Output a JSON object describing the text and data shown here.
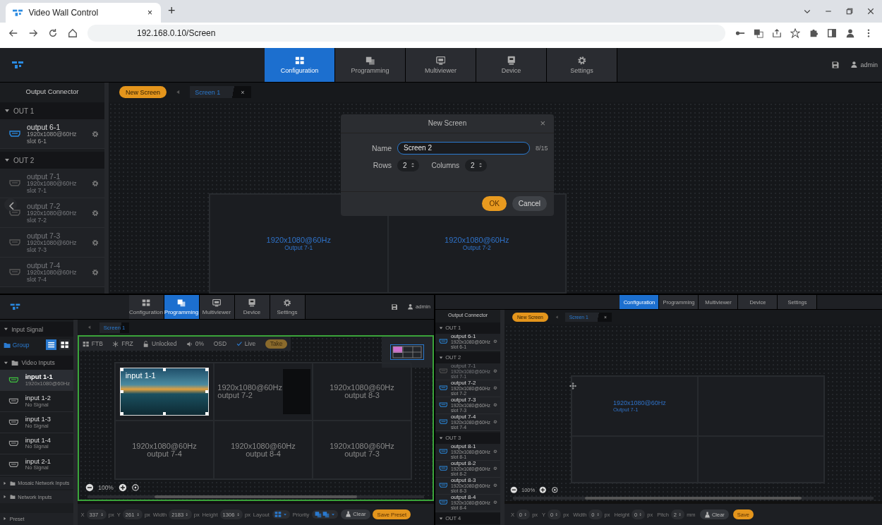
{
  "browser": {
    "tab_title": "Video Wall Control",
    "tab_close": "×",
    "new_tab": "+",
    "address": "192.168.0.10/Screen"
  },
  "top_app": {
    "nav": [
      {
        "label": "Configuration",
        "selected": true
      },
      {
        "label": "Programming",
        "selected": false
      },
      {
        "label": "Multiviewer",
        "selected": false
      },
      {
        "label": "Device",
        "selected": false
      },
      {
        "label": "Settings",
        "selected": false
      }
    ],
    "user": "admin",
    "sidebar_title": "Output Connector",
    "groups": [
      {
        "label": "OUT 1",
        "expanded": true,
        "outputs": [
          {
            "name": "output 6-1",
            "resolution": "1920x1080@60Hz",
            "slot": "slot 6-1",
            "active": true
          }
        ]
      },
      {
        "label": "OUT 2",
        "expanded": true,
        "outputs": [
          {
            "name": "output 7-1",
            "resolution": "1920x1080@60Hz",
            "slot": "slot 7-1",
            "active": false
          },
          {
            "name": "output 7-2",
            "resolution": "1920x1080@60Hz",
            "slot": "slot 7-2",
            "active": false
          },
          {
            "name": "output 7-3",
            "resolution": "1920x1080@60Hz",
            "slot": "slot 7-3",
            "active": false
          },
          {
            "name": "output 7-4",
            "resolution": "1920x1080@60Hz",
            "slot": "slot 7-4",
            "active": false
          }
        ]
      }
    ],
    "new_screen": "New Screen",
    "screen_tab": "Screen 1",
    "screen_tab_close": "×",
    "cells": [
      {
        "kind": "output",
        "resolution": "1920x1080@60Hz",
        "output": "Output 7-1"
      },
      {
        "kind": "output",
        "resolution": "1920x1080@60Hz",
        "output": "Output 7-2"
      }
    ],
    "dialog": {
      "title": "New Screen",
      "close": "×",
      "name_label": "Name",
      "name_value": "Screen 2",
      "counter": "8/15",
      "rows_label": "Rows",
      "rows_value": "2",
      "columns_label": "Columns",
      "columns_value": "2",
      "ok": "OK",
      "cancel": "Cancel"
    }
  },
  "programming_app": {
    "nav": [
      {
        "label": "Configuration",
        "selected": false
      },
      {
        "label": "Programming",
        "selected": true
      },
      {
        "label": "Multiviewer",
        "selected": false
      },
      {
        "label": "Device",
        "selected": false
      },
      {
        "label": "Settings",
        "selected": false
      }
    ],
    "user": "admin",
    "input_signal": "Input Signal",
    "group_button": "Group",
    "video_inputs": {
      "label": "Video Inputs",
      "expanded": true,
      "inputs": [
        {
          "name": "input 1-1",
          "status": "1920x1080@60Hz",
          "active": true
        },
        {
          "name": "input 1-2",
          "status": "No Signal",
          "active": false
        },
        {
          "name": "input 1-3",
          "status": "No Signal",
          "active": false
        },
        {
          "name": "input 1-4",
          "status": "No Signal",
          "active": false
        },
        {
          "name": "input 2-1",
          "status": "No Signal",
          "active": false
        }
      ]
    },
    "sections": [
      "Mosaic Network Inputs",
      "Network Inputs"
    ],
    "preset": "Preset",
    "screen_tab": "Screen 1",
    "toolbar": [
      "FTB",
      "FRZ",
      "Unlocked",
      "0%",
      "OSD"
    ],
    "live": {
      "label": "Live",
      "checked": true
    },
    "take": "Take",
    "cells": [
      {
        "kind": "window",
        "label": "input 1-1"
      },
      {
        "kind": "output",
        "resolution": "1920x1080@60Hz",
        "output": "output 7-2",
        "covered": true
      },
      {
        "kind": "output",
        "resolution": "1920x1080@60Hz",
        "output": "output 8-3",
        "covered": false
      },
      {
        "kind": "output",
        "resolution": "1920x1080@60Hz",
        "output": "output 7-4",
        "covered": false
      },
      {
        "kind": "output",
        "resolution": "1920x1080@60Hz",
        "output": "output 8-4",
        "covered": false
      },
      {
        "kind": "output",
        "resolution": "1920x1080@60Hz",
        "output": "output 7-3",
        "covered": false
      }
    ],
    "zoom": "100%",
    "fields": [
      {
        "label": "X",
        "value": "337",
        "unit": "px"
      },
      {
        "label": "Y",
        "value": "261",
        "unit": "px"
      },
      {
        "label": "Width",
        "value": "2183",
        "unit": "px"
      },
      {
        "label": "Height",
        "value": "1306",
        "unit": "px"
      }
    ],
    "layout_label": "Layout",
    "priority_label": "Priority",
    "clear": "Clear",
    "save": "Save Preset"
  },
  "configuration_app": {
    "nav": [
      {
        "label": "Configuration",
        "selected": true
      },
      {
        "label": "Programming",
        "selected": false
      },
      {
        "label": "Multiviewer",
        "selected": false
      },
      {
        "label": "Device",
        "selected": false
      },
      {
        "label": "Settings",
        "selected": false
      }
    ],
    "sidebar_title": "Output Connector",
    "groups": [
      {
        "label": "OUT 1",
        "expanded": true,
        "outputs": [
          {
            "name": "output 6-1",
            "resolution": "1920x1080@60Hz",
            "slot": "slot 6-1",
            "active": true
          }
        ]
      },
      {
        "label": "OUT 2",
        "expanded": true,
        "outputs": [
          {
            "name": "output 7-1",
            "resolution": "1920x1080@60Hz",
            "slot": "slot 7-1",
            "active": false
          },
          {
            "name": "output 7-2",
            "resolution": "1920x1080@60Hz",
            "slot": "slot 7-2",
            "active": true
          },
          {
            "name": "output 7-3",
            "resolution": "1920x1080@60Hz",
            "slot": "slot 7-3",
            "active": true
          },
          {
            "name": "output 7-4",
            "resolution": "1920x1080@60Hz",
            "slot": "slot 7-4",
            "active": true
          }
        ]
      },
      {
        "label": "OUT 3",
        "expanded": true,
        "outputs": [
          {
            "name": "output 8-1",
            "resolution": "1920x1080@60Hz",
            "slot": "slot 8-1",
            "active": true
          },
          {
            "name": "output 8-2",
            "resolution": "1920x1080@60Hz",
            "slot": "slot 8-2",
            "active": true
          },
          {
            "name": "output 8-3",
            "resolution": "1920x1080@60Hz",
            "slot": "slot 8-3",
            "active": true
          },
          {
            "name": "output 8-4",
            "resolution": "1920x1080@60Hz",
            "slot": "slot 8-4",
            "active": true
          }
        ]
      },
      {
        "label": "OUT 4",
        "expanded": true
      }
    ],
    "new_screen": "New Screen",
    "screen_tab": "Screen 1",
    "screen_tab_close": "×",
    "cells": [
      {
        "kind": "output",
        "resolution": "1920x1080@60Hz",
        "output": "Output 7-1"
      },
      {
        "kind": "empty"
      },
      {
        "kind": "empty"
      },
      {
        "kind": "empty"
      }
    ],
    "zoom": "100%",
    "fields": [
      {
        "label": "X",
        "value": "0",
        "unit": "px"
      },
      {
        "label": "Y",
        "value": "0",
        "unit": "px"
      },
      {
        "label": "Width",
        "value": "0",
        "unit": "px"
      },
      {
        "label": "Height",
        "value": "0",
        "unit": "px"
      },
      {
        "label": "Pitch",
        "value": "2",
        "unit": "mm"
      }
    ],
    "clear": "Clear",
    "save": "Save"
  }
}
